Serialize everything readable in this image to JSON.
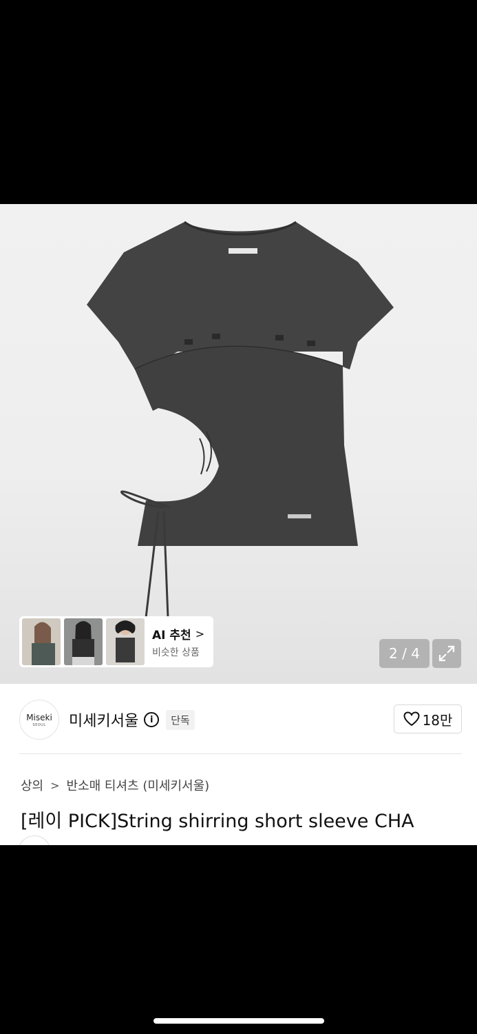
{
  "ai_recommend": {
    "title": "AI 추천",
    "chevron": ">",
    "subtitle": "비슷한 상품",
    "thumbnails": [
      "model-photo-1",
      "model-photo-2",
      "model-photo-3"
    ]
  },
  "gallery": {
    "counter": "2 / 4",
    "fullscreen_icon": "expand-icon",
    "current_page": 2,
    "total_pages": 4
  },
  "brand": {
    "logo_text": "Miseki",
    "logo_subtext": "SEOUL",
    "name": "미세키서울",
    "info_icon": "i",
    "badge": "단독"
  },
  "like": {
    "icon": "heart-icon",
    "count": "18만"
  },
  "breadcrumb": {
    "category": "상의",
    "separator": ">",
    "subcategory": "반소매 티셔츠 (미세키서울)"
  },
  "product": {
    "title": "[레이 PICK]String shirring short sleeve CHA",
    "title_overflow": "…"
  },
  "colors": {
    "shirt": "#424242",
    "counter_bg": "rgba(120,120,120,0.45)",
    "background": "#000000"
  }
}
